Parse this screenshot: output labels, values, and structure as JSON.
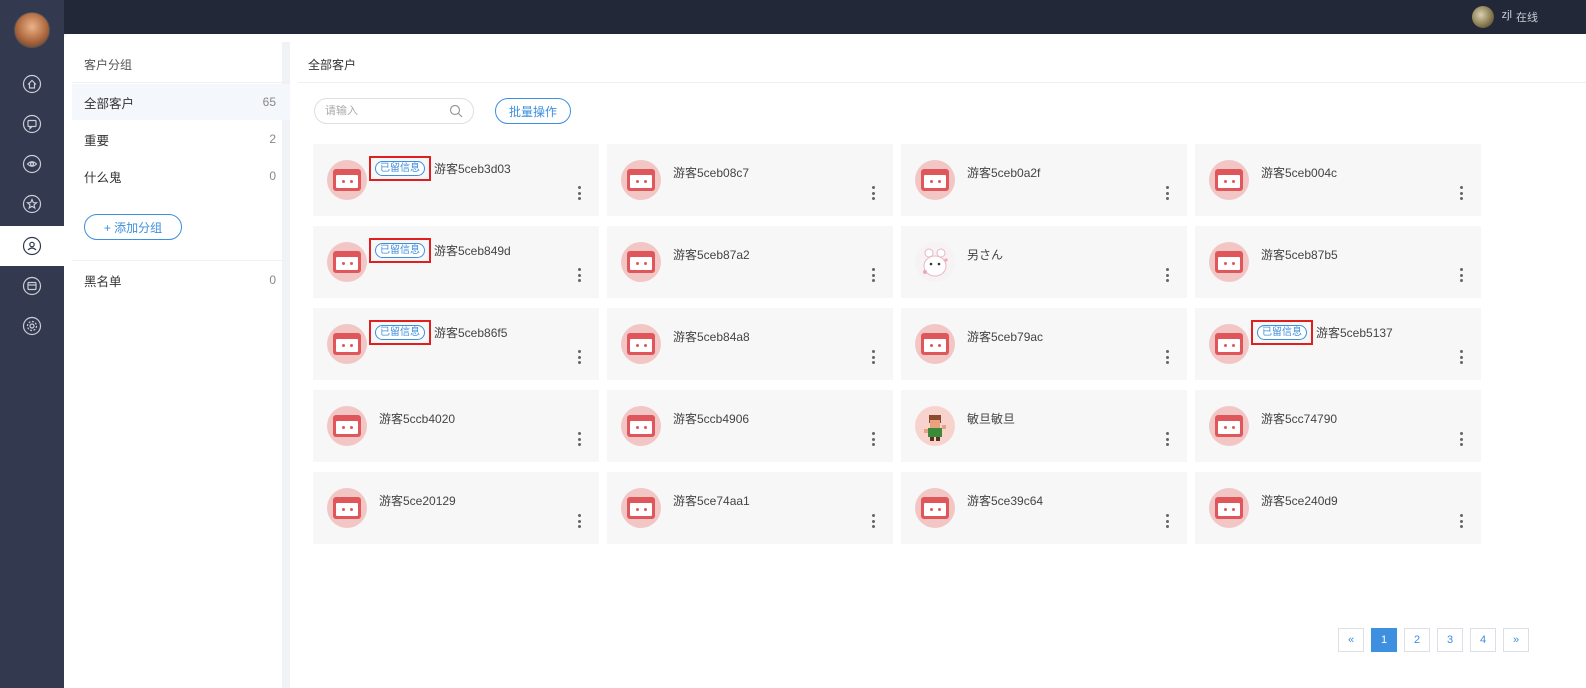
{
  "topbar": {
    "user_name": "zjl",
    "user_status": "在线"
  },
  "rail": {
    "icons": [
      "home-icon",
      "chat-icon",
      "eye-icon",
      "star-icon",
      "customer-icon",
      "calendar-icon",
      "settings-icon"
    ],
    "active_index": 4
  },
  "groups": {
    "title": "客户分组",
    "items": [
      {
        "label": "全部客户",
        "count": "65"
      },
      {
        "label": "重要",
        "count": "2"
      },
      {
        "label": "什么鬼",
        "count": "0"
      }
    ],
    "add_label": "+ 添加分组",
    "blacklist": {
      "label": "黑名单",
      "count": "0"
    }
  },
  "content": {
    "title": "全部客户",
    "search_placeholder": "请输入",
    "batch_label": "批量操作"
  },
  "cards": [
    {
      "name": "游客5ceb3d03",
      "tag": "已留信息"
    },
    {
      "name": "游客5ceb08c7",
      "tag": ""
    },
    {
      "name": "游客5ceb0a2f",
      "tag": ""
    },
    {
      "name": "游客5ceb004c",
      "tag": ""
    },
    {
      "name": "游客5ceb849d",
      "tag": "已留信息"
    },
    {
      "name": "游客5ceb87a2",
      "tag": ""
    },
    {
      "name": "另さん",
      "tag": "",
      "avatar": "custom-a"
    },
    {
      "name": "游客5ceb87b5",
      "tag": ""
    },
    {
      "name": "游客5ceb86f5",
      "tag": "已留信息"
    },
    {
      "name": "游客5ceb84a8",
      "tag": ""
    },
    {
      "name": "游客5ceb79ac",
      "tag": ""
    },
    {
      "name": "游客5ceb5137",
      "tag": "已留信息"
    },
    {
      "name": "游客5ccb4020",
      "tag": ""
    },
    {
      "name": "游客5ccb4906",
      "tag": ""
    },
    {
      "name": "敏旦敏旦",
      "tag": "",
      "avatar": "custom-b"
    },
    {
      "name": "游客5cc74790",
      "tag": ""
    },
    {
      "name": "游客5ce20129",
      "tag": ""
    },
    {
      "name": "游客5ce74aa1",
      "tag": ""
    },
    {
      "name": "游客5ce39c64",
      "tag": ""
    },
    {
      "name": "游客5ce240d9",
      "tag": ""
    }
  ],
  "pagination": {
    "prev": "«",
    "next": "»",
    "pages": [
      "1",
      "2",
      "3",
      "4"
    ],
    "current": "1"
  },
  "colors": {
    "accent": "#3d8fdf",
    "rail": "#333a4f",
    "topbar": "#232838",
    "highlight": "#e02020"
  }
}
